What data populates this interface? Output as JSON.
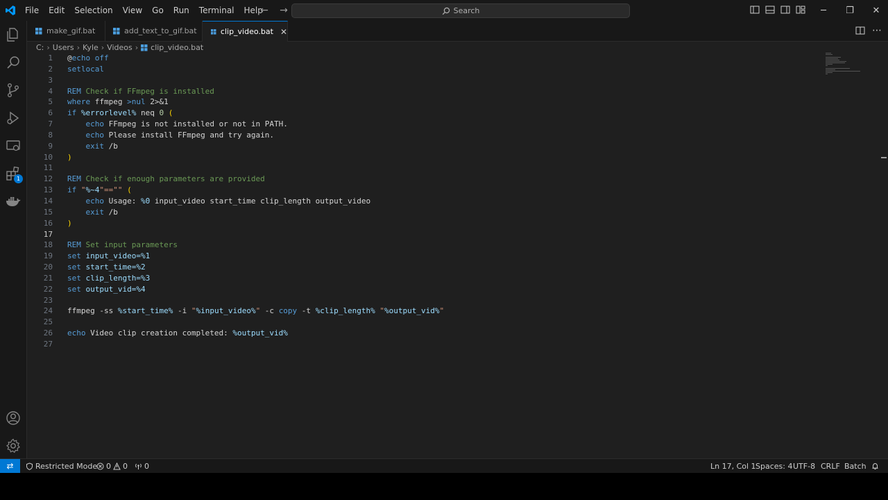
{
  "menu": [
    "File",
    "Edit",
    "Selection",
    "View",
    "Go",
    "Run",
    "Terminal",
    "Help"
  ],
  "search": {
    "label": "Search"
  },
  "tabs": [
    {
      "label": "make_gif.bat"
    },
    {
      "label": "add_text_to_gif.bat"
    },
    {
      "label": "clip_video.bat"
    }
  ],
  "breadcrumb": [
    "C:",
    "Users",
    "Kyle",
    "Videos",
    "clip_video.bat"
  ],
  "activity_badge": "1",
  "code": {
    "line_numbers": [
      "1",
      "2",
      "3",
      "4",
      "5",
      "6",
      "7",
      "8",
      "9",
      "10",
      "11",
      "12",
      "13",
      "14",
      "15",
      "16",
      "17",
      "18",
      "19",
      "20",
      "21",
      "22",
      "23",
      "24",
      "25",
      "26",
      "27"
    ],
    "l1a": "@",
    "l1b": "echo off",
    "l2": "setlocal",
    "l4a": "REM",
    "l4b": " Check if FFmpeg is installed",
    "l5a": "where",
    "l5b": " ffmpeg ",
    "l5c": ">nul",
    "l5d": " 2>&1",
    "l6a": "if ",
    "l6b": "%errorlevel%",
    "l6c": " neq ",
    "l6d": "0",
    "l6e": " (",
    "l7a": "echo",
    "l7b": " FFmpeg is not installed or not in PATH.",
    "l8a": "echo",
    "l8b": " Please install FFmpeg and try again.",
    "l9a": "exit",
    "l9b": " /b",
    "l10": ")",
    "l12a": "REM",
    "l12b": " Check if enough parameters are provided",
    "l13a": "if ",
    "l13b": "\"",
    "l13c": "%~4",
    "l13d": "\"==\"\"",
    "l13e": " (",
    "l14a": "echo",
    "l14b": " Usage: ",
    "l14c": "%0",
    "l14d": " input_video start_time clip_length output_video",
    "l15a": "exit",
    "l15b": " /b",
    "l16": ")",
    "l18a": "REM",
    "l18b": " Set input parameters",
    "l19a": "set",
    "l19b": " input_video=",
    "l19c": "%1",
    "l20a": "set",
    "l20b": " start_time=",
    "l20c": "%2",
    "l21a": "set",
    "l21b": " clip_length=",
    "l21c": "%3",
    "l22a": "set",
    "l22b": " output_vid=",
    "l22c": "%4",
    "l24a": "ffmpeg -ss ",
    "l24b": "%start_time%",
    "l24c": " -i ",
    "l24d": "\"",
    "l24e": "%input_video%",
    "l24f": "\"",
    "l24g": " -c ",
    "l24h": "copy",
    "l24i": " -t ",
    "l24j": "%clip_length%",
    "l24k": " \"",
    "l24l": "%output_vid%",
    "l24m": "\"",
    "l26a": "echo",
    "l26b": " Video clip creation completed: ",
    "l26c": "%output_vid%"
  },
  "status": {
    "restricted": "Restricted Mode",
    "errors": "0",
    "warnings": "0",
    "ports": "0",
    "position": "Ln 17, Col 1",
    "spaces": "Spaces: 4",
    "encoding": "UTF-8",
    "eol": "CRLF",
    "language": "Batch"
  },
  "colors": {
    "accent": "#0078d4",
    "keyword": "#569cd6",
    "comment": "#6a9955",
    "variable": "#9cdcfe",
    "string": "#ce9178",
    "bracket": "#ffd700"
  }
}
